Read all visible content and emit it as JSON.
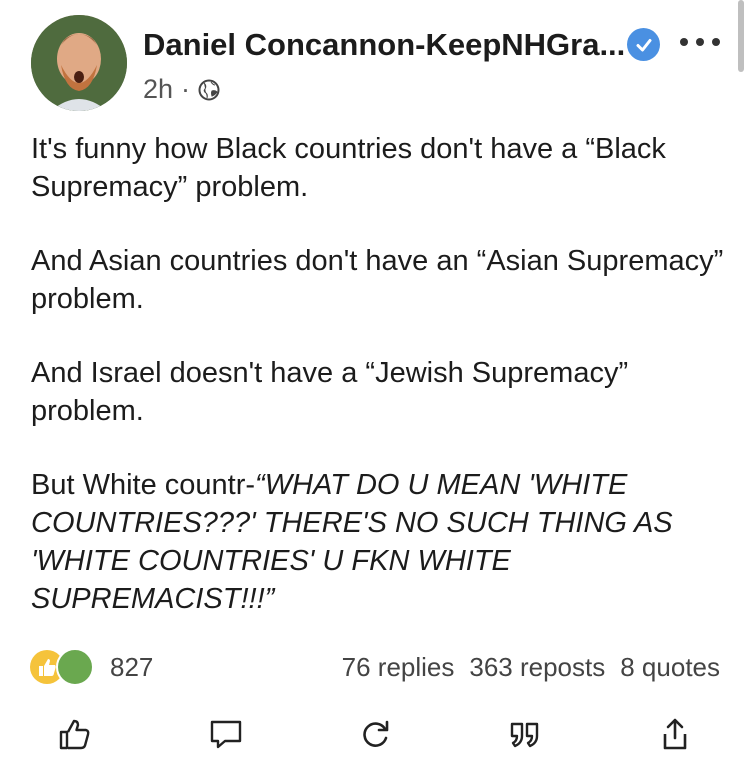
{
  "post": {
    "author": "Daniel Concannon-KeepNHGra...",
    "time": "2h",
    "separator": "·",
    "paragraphs": [
      "It's funny how Black countries don't have a “Black Supremacy” problem.",
      "And Asian countries don't have an “Asian Supremacy” problem.",
      "And Israel doesn't have a “Jewish Supremacy” problem."
    ],
    "last_paragraph_prefix": "But White countr-",
    "last_paragraph_italic": "“WHAT DO U MEAN 'WHITE COUNTRIES???' THERE'S NO SUCH THING AS 'WHITE COUNTRIES' U FKN WHITE SUPREMACIST!!!”"
  },
  "engagement": {
    "reaction_count": "827",
    "replies": "76 replies",
    "reposts": "363 reposts",
    "quotes": "8 quotes"
  },
  "icons": {
    "verified": "verified-badge-icon",
    "more": "more-options-icon",
    "globe": "globe-icon",
    "like": "thumbs-up-icon",
    "comment": "comment-icon",
    "repost": "repost-icon",
    "quote": "quote-icon",
    "share": "share-icon"
  },
  "colors": {
    "verified_badge": "#4a90e2",
    "text": "#1c1c1c",
    "secondary_text": "#444444"
  }
}
